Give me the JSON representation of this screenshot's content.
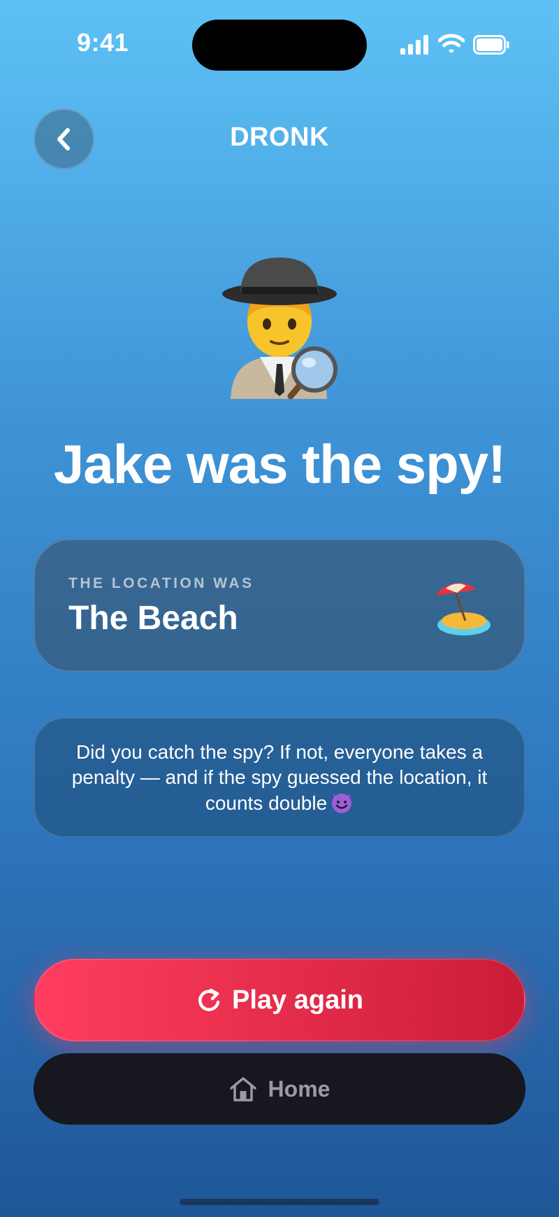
{
  "status_bar": {
    "time": "9:41",
    "icons": [
      "signal-icon",
      "wifi-icon",
      "battery-icon"
    ]
  },
  "header": {
    "title": "DRONK",
    "back_icon": "chevron-left-icon"
  },
  "result": {
    "emoji": "detective-emoji",
    "headline": "Jake was the spy!"
  },
  "location_card": {
    "label": "THE LOCATION WAS",
    "name": "The Beach",
    "icon": "beach-island-emoji"
  },
  "info_card": {
    "text": "Did you catch the spy? If not, everyone takes a penalty — and if the spy guessed the location, it counts double",
    "icon": "smiling-devil-emoji"
  },
  "buttons": {
    "play_again": "Play again",
    "play_again_icon": "restart-icon",
    "home": "Home",
    "home_icon": "house-icon"
  },
  "colors": {
    "primary_button": "#e32b4a",
    "secondary_button": "#17171f"
  }
}
